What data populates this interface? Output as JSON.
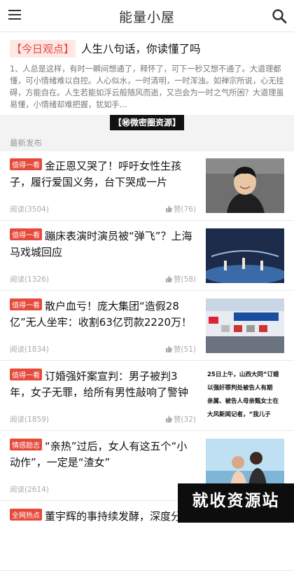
{
  "header": {
    "title": "能量小屋"
  },
  "featured": {
    "tag": "【今日观点】",
    "headline": "人生八句话，你读懂了吗",
    "excerpt": "1、人总是这样，有时一瞬间想通了，释怀了，可下一秒又想不通了。大道理都懂，可小情绪难以自控。人心似水，一时清明，一时浑浊。如禅宗所说，心无挂碍，方能自在。人生若能如浮云般随风而逝，又岂会为一时之气所困？大道理虽易懂，小情绪却难把握，犹如手..."
  },
  "watermark_top": "【㊙微密圈资源】",
  "section": {
    "label": "最新发布"
  },
  "articles": [
    {
      "category": "值得一看",
      "title": "金正恩又哭了！呼吁女性生孩子，履行爱国义务，台下哭成一片",
      "reads": "阅读(3504)",
      "likes": "赞(76)",
      "category_color": "#e64a3b"
    },
    {
      "category": "值得一看",
      "title": "蹦床表演时演员被“弹飞”？上海马戏城回应",
      "reads": "阅读(1326)",
      "likes": "赞(58)",
      "category_color": "#e64a3b"
    },
    {
      "category": "值得一看",
      "title": "散户血亏！庞大集团“造假28亿”无人坐牢：收割63亿罚款2220万！",
      "reads": "阅读(1834)",
      "likes": "赞(51)",
      "category_color": "#e64a3b"
    },
    {
      "category": "值得一看",
      "title": "订婚强奸案宣判：男子被判3年，女子无罪，给所有男性敲响了警钟",
      "reads": "阅读(1859)",
      "likes": "赞(32)",
      "category_color": "#e64a3b"
    },
    {
      "category": "情感励志",
      "title": "“亲热”过后，女人有这五个“小动作”，一定是“渣女”",
      "reads": "阅读(2614)",
      "likes": "",
      "category_color": "#e64a3b"
    },
    {
      "category": "全网热点",
      "title": "董宇辉的事持续发酵，深度分析",
      "reads": "",
      "likes": "",
      "category_color": "#e64a3b"
    }
  ],
  "news_clip_text": [
    "25日上午，山西大同“订婚",
    "以强奸罪判处被告人有期",
    "亲属、被告人母亲甄女士在",
    "大风新闻记者，“我儿子"
  ],
  "watermark_bottom": "就收资源站",
  "colors": {
    "accent": "#e64a3b",
    "meta": "#aaaaaa"
  }
}
